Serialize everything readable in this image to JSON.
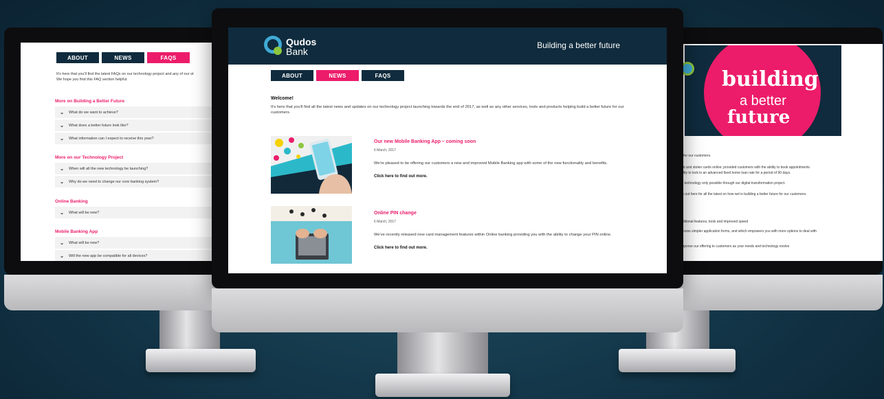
{
  "left_screen": {
    "tabs": [
      {
        "label": "ABOUT",
        "active": false
      },
      {
        "label": "NEWS",
        "active": false
      },
      {
        "label": "FAQS",
        "active": true
      }
    ],
    "intro_lines": [
      "It's here that you'll find the latest FAQs on our technology project and any of our ot",
      "We hope you find this FAQ section helpful."
    ],
    "sections": [
      {
        "heading": "More on Building a Better Future",
        "items": [
          "What do we want to achieve?",
          "What does a better future look like?",
          "What information can I expect to receive this year?"
        ]
      },
      {
        "heading": "More on our Technology Project",
        "items": [
          "When will all the new technology be launching?",
          "Why do we need to change our core banking system?"
        ]
      },
      {
        "heading": "Online Banking",
        "items": [
          "What will be new?"
        ]
      },
      {
        "heading": "Mobile Banking App",
        "items": [
          "What will be new?",
          "Will the new app be compatible for all devices?"
        ]
      }
    ]
  },
  "center_screen": {
    "logo_line1": "Qudos",
    "logo_line2": "Bank",
    "tagline": "Building a better future",
    "tabs": [
      {
        "label": "ABOUT",
        "active": false
      },
      {
        "label": "NEWS",
        "active": true
      },
      {
        "label": "FAQS",
        "active": false
      }
    ],
    "welcome_title": "Welcome!",
    "welcome_body": "It's here that you'll find all the latest news and updates on our technology project launching towards the end of 2017, as well as any other services, tools and products helping build a better future for our customers.",
    "news": [
      {
        "title": "Our new Mobile Banking App – coming soon",
        "date": "6 March, 2017",
        "body": "We're pleased to be offering our customers a new and improved Mobile Banking app with some of the new functionality and benefits.",
        "link": "Click here to find out more."
      },
      {
        "title": "Online PIN change",
        "date": "6 March, 2017",
        "body": "We've recently released new card management features within Online banking providing you with the ability to change your PIN online.",
        "link": "Click here to find out more."
      }
    ]
  },
  "right_screen": {
    "hero_word1": "building",
    "hero_word2": "a better",
    "hero_word3": "future",
    "lines": [
      "e for our customers.",
      "ost and stolen cards online; provided customers with the ability to book appointments",
      "bility to lock in an advanced fixed home loan rate for a period of 90 days.",
      "of technology only possible through our digital transformation project.",
      "ck out here for all the latest on how we're building a better future for our customers.",
      "dditional features, tools and improved speed",
      "rocess simpler application forms, and which empowers you with more options to deal with",
      "improve our offering to customers as your needs and technology evolve"
    ]
  },
  "colors": {
    "navy": "#0f2b3d",
    "pink": "#ec1c6a",
    "logo_blue": "#3fa9d5",
    "logo_green": "#8dc63f"
  }
}
